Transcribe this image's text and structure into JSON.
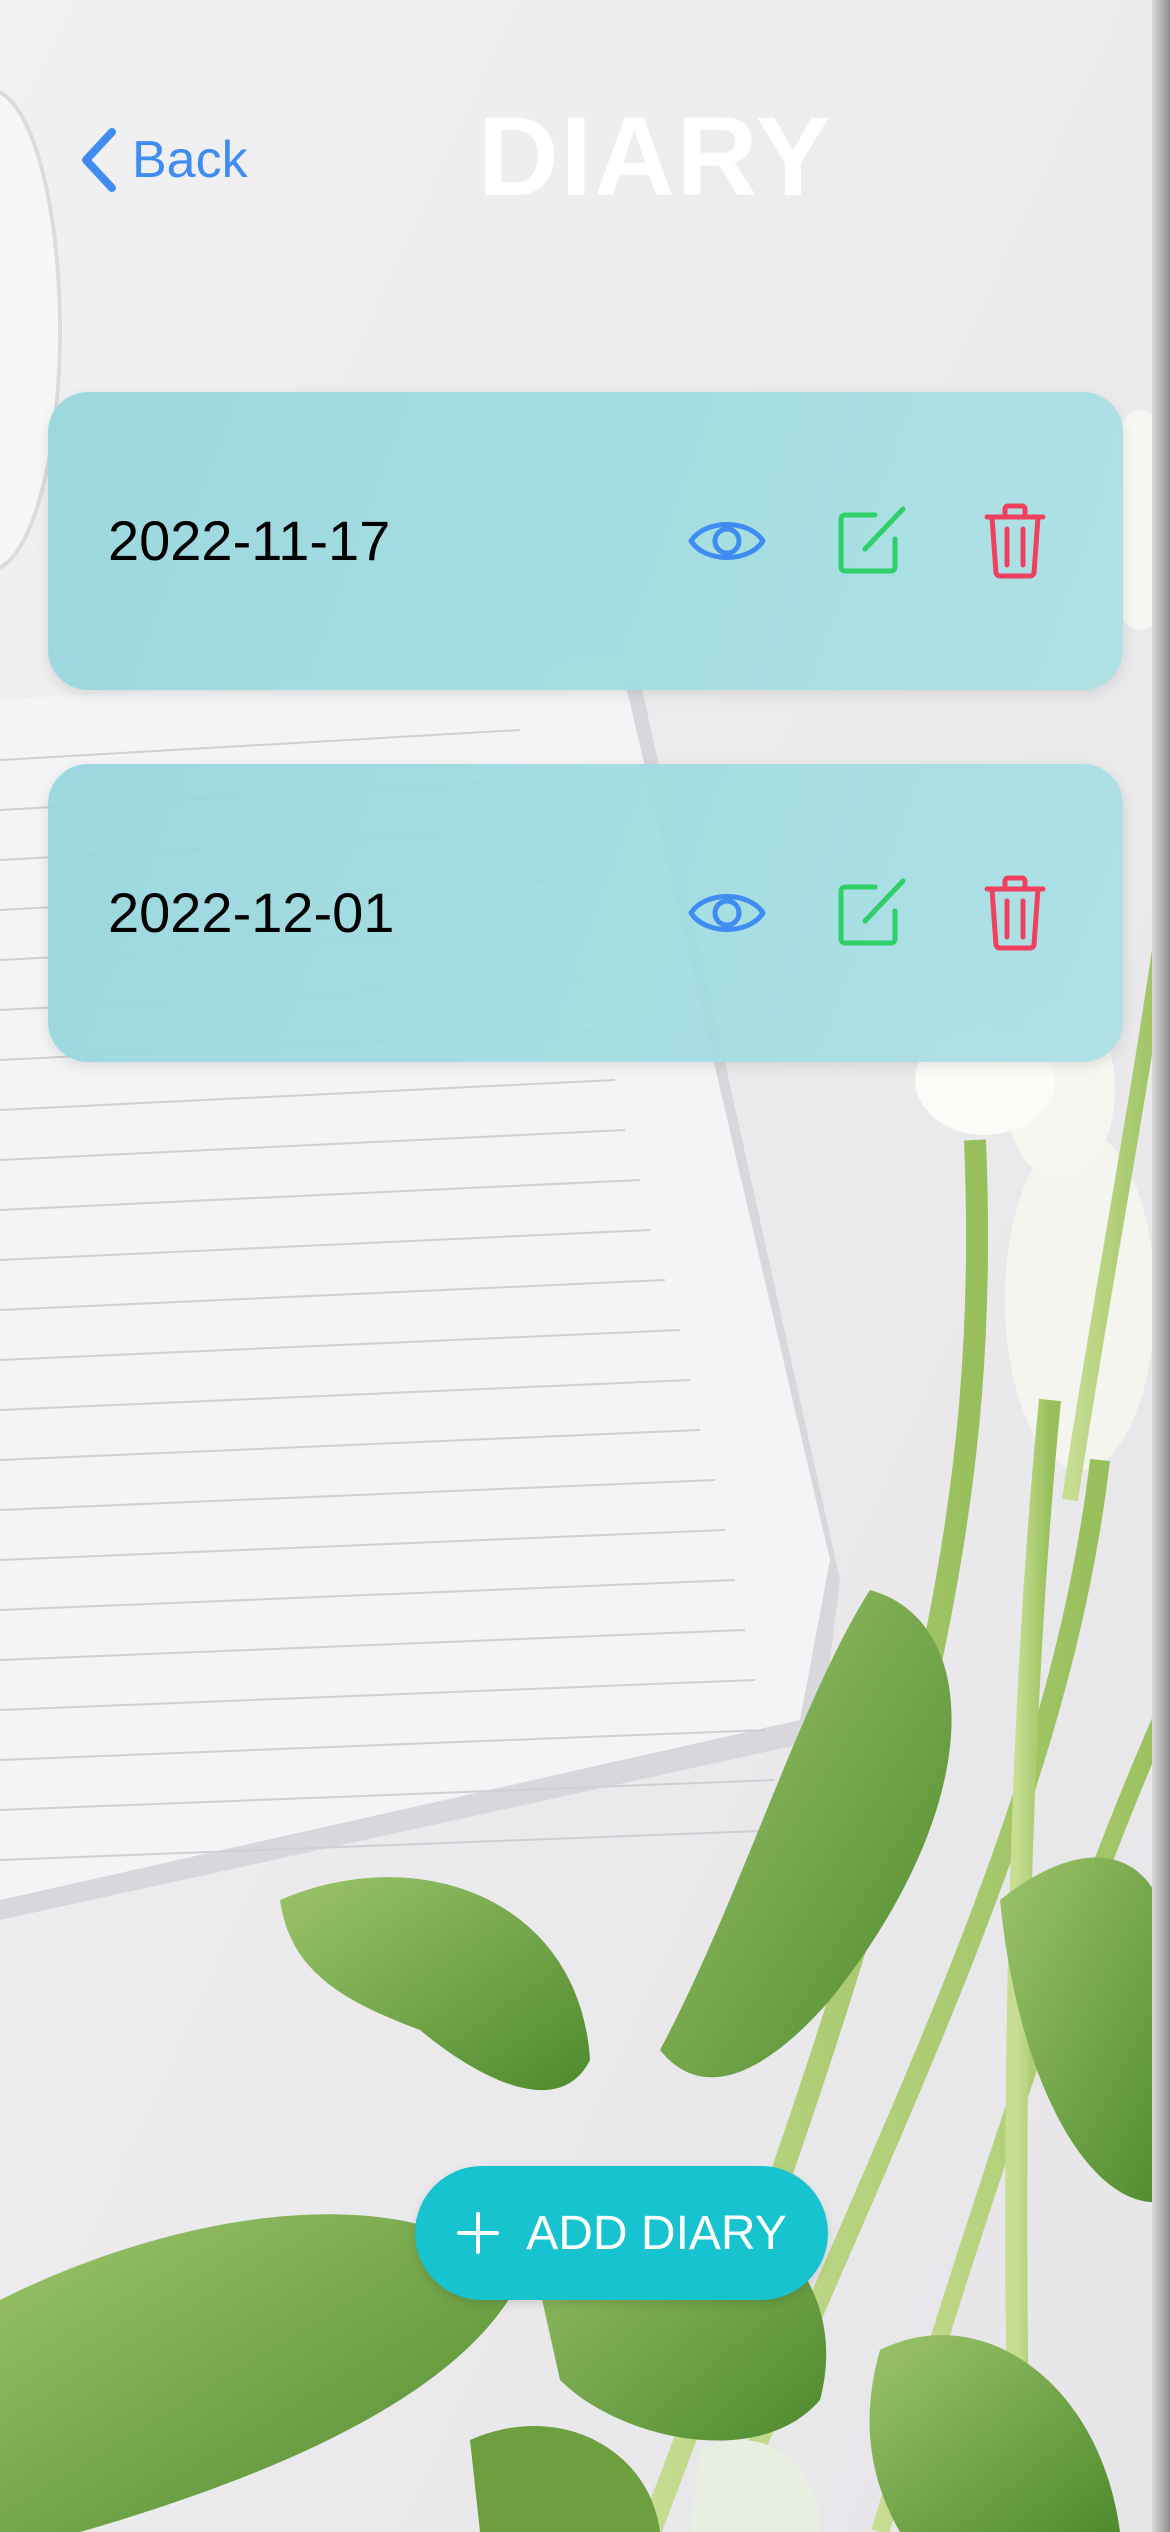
{
  "header": {
    "back_label": "Back",
    "title": "DIARY"
  },
  "diaries": [
    {
      "date": "2022-11-17"
    },
    {
      "date": "2022-12-01"
    }
  ],
  "add_button": {
    "label": "ADD DIARY"
  },
  "icons": {
    "back": "chevron-left-icon",
    "view": "eye-icon",
    "edit": "edit-icon",
    "delete": "trash-icon",
    "add": "plus-icon"
  },
  "colors": {
    "accent_blue": "#3f8cf2",
    "edit_green": "#2fcf6a",
    "delete_red": "#ef4060",
    "card_bg": "#9ed8dc",
    "add_button_bg": "#17c3cf",
    "title_text": "#ffffff"
  }
}
